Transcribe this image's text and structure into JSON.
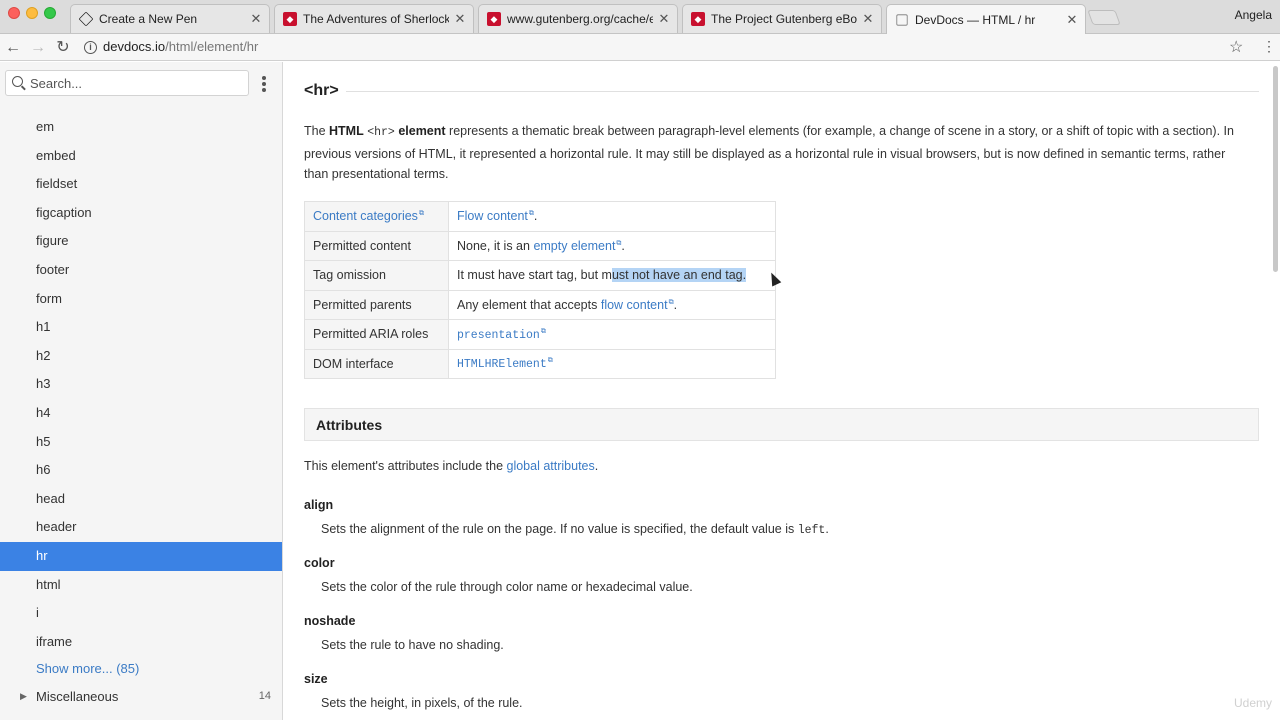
{
  "browser": {
    "tabs": [
      {
        "title": "Create a New Pen",
        "icon": "codepen-icon"
      },
      {
        "title": "The Adventures of Sherlock Ho",
        "icon": "gutenberg-icon"
      },
      {
        "title": "www.gutenberg.org/cache/epu",
        "icon": "gutenberg-icon"
      },
      {
        "title": "The Project Gutenberg eBook o",
        "icon": "gutenberg-icon"
      },
      {
        "title": "DevDocs — HTML / hr",
        "icon": "devdocs-icon"
      }
    ],
    "profile": "Angela",
    "url_host": "devdocs.io",
    "url_path": "/html/element/hr"
  },
  "sidebar": {
    "search_placeholder": "Search...",
    "items": [
      "em",
      "embed",
      "fieldset",
      "figcaption",
      "figure",
      "footer",
      "form",
      "h1",
      "h2",
      "h3",
      "h4",
      "h5",
      "h6",
      "head",
      "header",
      "hr",
      "html",
      "i",
      "iframe"
    ],
    "active_index": 15,
    "show_more": "Show more... (85)",
    "misc_label": "Miscellaneous",
    "misc_count": "14"
  },
  "main": {
    "title": "<hr>",
    "intro": {
      "p1": "The ",
      "html_word": "HTML",
      "tag": "<hr>",
      "element_word": "element",
      "p2": " represents a thematic break between paragraph-level elements (for example, a change of scene in a story, or a shift of topic with a section). In previous versions of HTML, it represented a horizontal rule. It may still be displayed as a horizontal rule in visual browsers, but is now defined in semantic terms, rather than presentational terms."
    },
    "table": {
      "r1_key": "Content categories",
      "r1_link": "Flow content",
      "r1_tail": ".",
      "r2_key": "Permitted content",
      "r2_pre": "None, it is an ",
      "r2_link": "empty element",
      "r2_tail": ".",
      "r3_key": "Tag omission",
      "r3_pre": "It must have start tag, but m",
      "r3_hl": "ust not have an end tag.",
      "r4_key": "Permitted parents",
      "r4_pre": "Any element that accepts ",
      "r4_link": "flow content",
      "r4_tail": ".",
      "r5_key": "Permitted ARIA roles",
      "r5_code": "presentation",
      "r6_key": "DOM interface",
      "r6_code": "HTMLHRElement"
    },
    "attributes_heading": "Attributes",
    "attr_intro_pre": "This element's attributes include the ",
    "attr_intro_link": "global attributes",
    "attr_intro_tail": ".",
    "attributes": [
      {
        "name": "align",
        "desc_pre": "Sets the alignment of the rule on the page. If no value is specified, the default value is ",
        "desc_code": "left",
        "desc_tail": "."
      },
      {
        "name": "color",
        "desc_pre": "Sets the color of the rule through color name or hexadecimal value.",
        "desc_code": "",
        "desc_tail": ""
      },
      {
        "name": "noshade",
        "desc_pre": "Sets the rule to have no shading.",
        "desc_code": "",
        "desc_tail": ""
      },
      {
        "name": "size",
        "desc_pre": "Sets the height, in pixels, of the rule.",
        "desc_code": "",
        "desc_tail": ""
      }
    ],
    "watermark": "Udemy"
  },
  "colors": {
    "accent": "#3b82e4",
    "link": "#3b7bc5",
    "highlight": "#b4d4f5"
  }
}
